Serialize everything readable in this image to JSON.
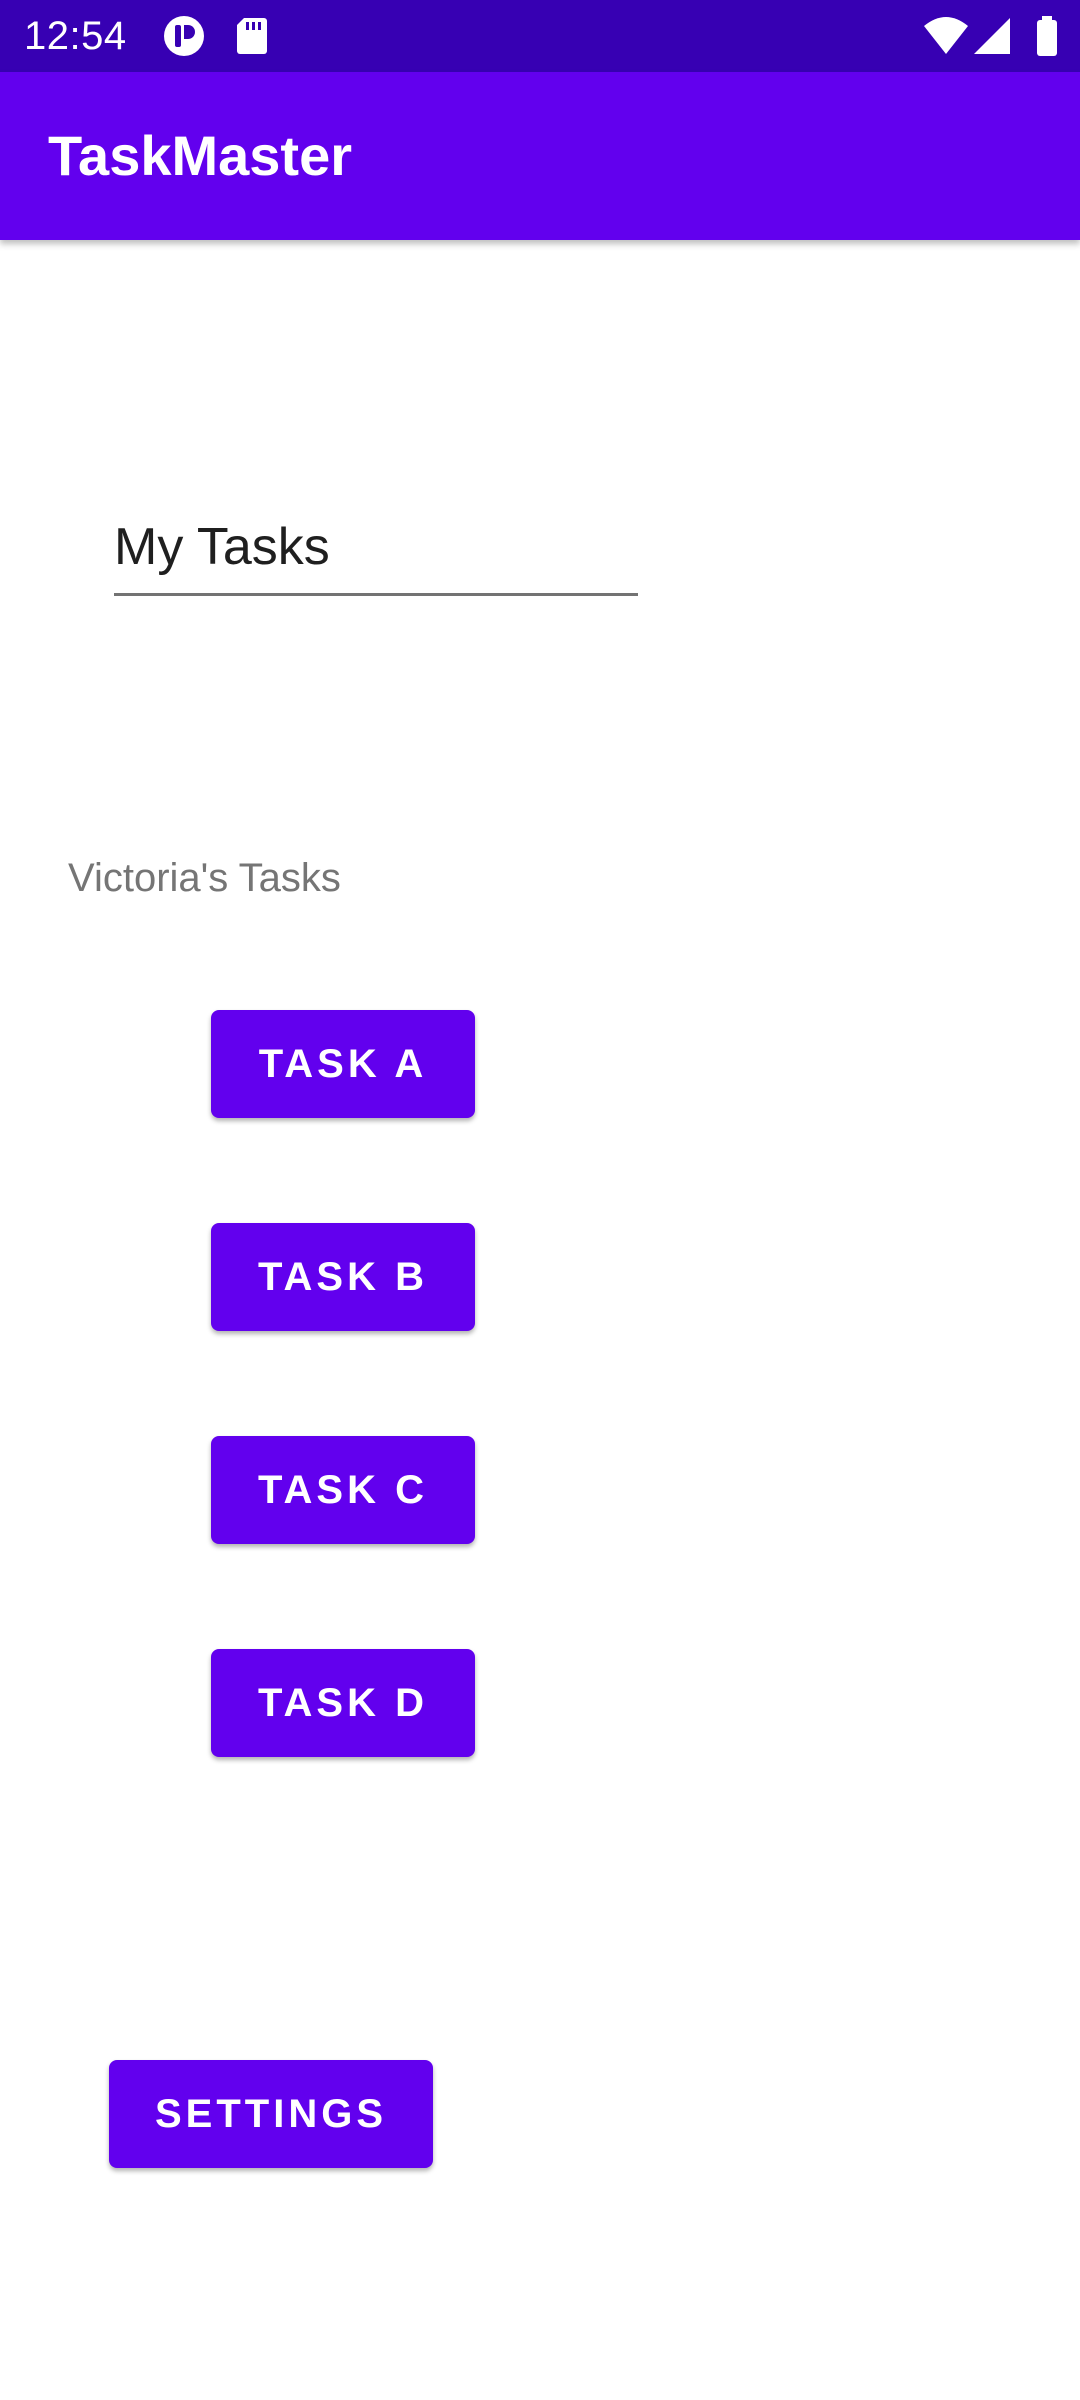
{
  "status_bar": {
    "time": "12:54",
    "icons": [
      "notification-app-icon",
      "sd-card-icon",
      "wifi-icon",
      "cell-signal-icon",
      "battery-icon"
    ]
  },
  "app_bar": {
    "title": "TaskMaster"
  },
  "task_title_field": {
    "value": "My Tasks"
  },
  "username_label": "Victoria's Tasks",
  "tasks": [
    {
      "label": "TASK A"
    },
    {
      "label": "TASK B"
    },
    {
      "label": "TASK C"
    },
    {
      "label": "TASK D"
    }
  ],
  "settings_button": {
    "label": "SETTINGS"
  },
  "colors": {
    "status_bar": "#3700b3",
    "primary": "#6200ee",
    "background": "#ffffff",
    "label_text": "#757575"
  }
}
